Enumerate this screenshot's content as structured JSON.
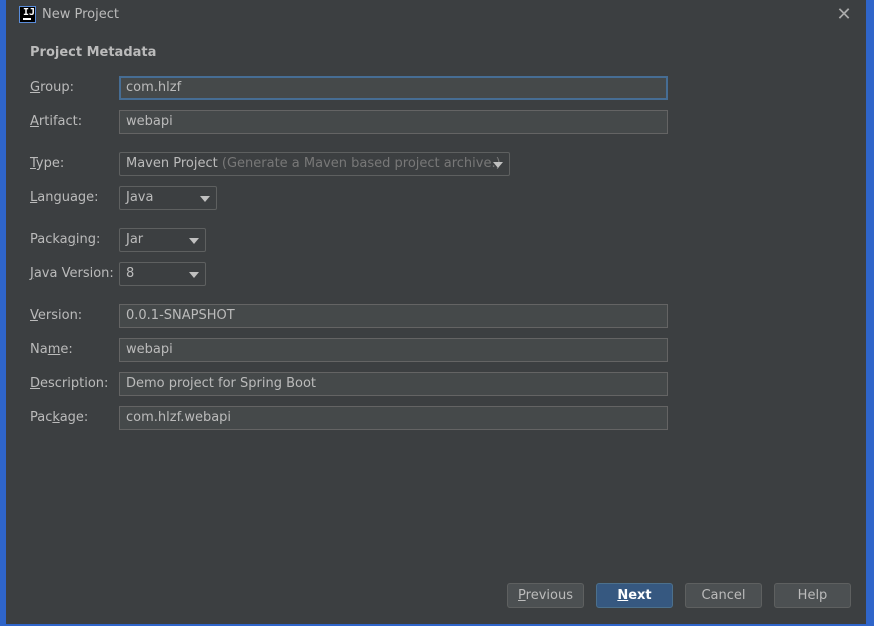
{
  "window": {
    "app_icon": "intellij-idea-icon",
    "title": "New Project",
    "close_icon": "close-icon"
  },
  "section_title": "Project Metadata",
  "form": {
    "group": {
      "label_mnemonic": "G",
      "label_rest": "roup:",
      "value": "com.hlzf"
    },
    "artifact": {
      "label_mnemonic": "A",
      "label_rest": "rtifact:",
      "value": "webapi"
    },
    "type": {
      "label_mnemonic": "T",
      "label_rest": "ype:",
      "value": "Maven Project",
      "hint": "(Generate a Maven based project archive.)"
    },
    "language": {
      "label_mnemonic": "L",
      "label_rest": "anguage:",
      "value": "Java"
    },
    "packaging": {
      "label_pre": "Packa",
      "label_mnemonic": "g",
      "label_rest": "ing:",
      "value": "Jar"
    },
    "java_version": {
      "label_mnemonic": "J",
      "label_rest": "ava Version:",
      "value": "8"
    },
    "version": {
      "label_mnemonic": "V",
      "label_rest": "ersion:",
      "value": "0.0.1-SNAPSHOT"
    },
    "name": {
      "label_pre": "Na",
      "label_mnemonic": "m",
      "label_rest": "e:",
      "value": "webapi"
    },
    "description": {
      "label_mnemonic": "D",
      "label_rest": "escription:",
      "value": "Demo project for Spring Boot"
    },
    "package": {
      "label_pre": "Pac",
      "label_mnemonic": "k",
      "label_rest": "age:",
      "value": "com.hlzf.webapi"
    }
  },
  "buttons": {
    "previous": {
      "mnemonic": "P",
      "rest": "revious"
    },
    "next": {
      "mnemonic": "N",
      "rest": "ext"
    },
    "cancel": "Cancel",
    "help": "Help"
  },
  "colors": {
    "background": "#3c3f41",
    "accent_border": "#2f65ca",
    "primary_button": "#365880",
    "focus_border": "#466d94"
  }
}
